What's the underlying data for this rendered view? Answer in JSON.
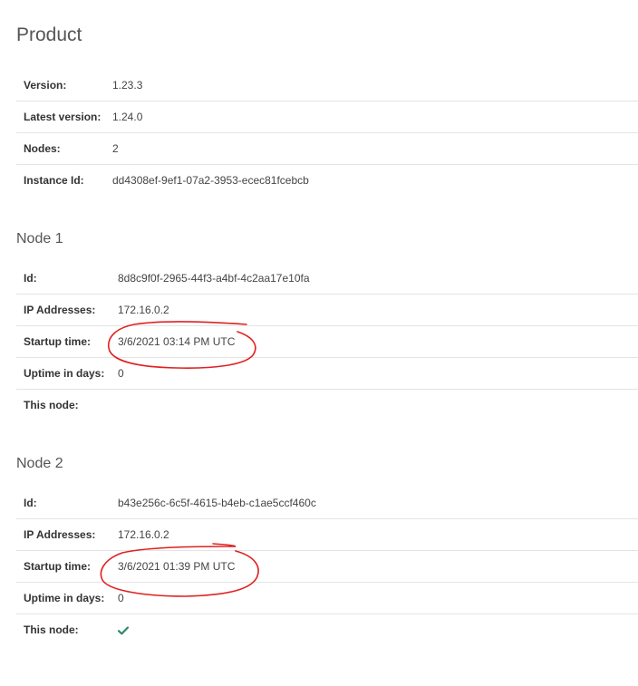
{
  "product": {
    "title": "Product",
    "rows": [
      {
        "label": "Version:",
        "value": "1.23.3"
      },
      {
        "label": "Latest version:",
        "value": "1.24.0"
      },
      {
        "label": "Nodes:",
        "value": "2"
      },
      {
        "label": "Instance Id:",
        "value": "dd4308ef-9ef1-07a2-3953-ecec81fcebcb"
      }
    ]
  },
  "nodes": [
    {
      "title": "Node 1",
      "rows": [
        {
          "label": "Id:",
          "value": "8d8c9f0f-2965-44f3-a4bf-4c2aa17e10fa"
        },
        {
          "label": "IP Addresses:",
          "value": "172.16.0.2"
        },
        {
          "label": "Startup time:",
          "value": "3/6/2021 03:14 PM UTC"
        },
        {
          "label": "Uptime in days:",
          "value": "0"
        },
        {
          "label": "This node:",
          "value": ""
        }
      ],
      "this_node": false
    },
    {
      "title": "Node 2",
      "rows": [
        {
          "label": "Id:",
          "value": "b43e256c-6c5f-4615-b4eb-c1ae5ccf460c"
        },
        {
          "label": "IP Addresses:",
          "value": "172.16.0.2"
        },
        {
          "label": "Startup time:",
          "value": "3/6/2021 01:39 PM UTC"
        },
        {
          "label": "Uptime in days:",
          "value": "0"
        },
        {
          "label": "This node:",
          "value": ""
        }
      ],
      "this_node": true
    }
  ],
  "colors": {
    "annotation": "#e02020",
    "check": "#2e8b6e"
  },
  "icons": {
    "this_node_indicator": "check-icon"
  }
}
